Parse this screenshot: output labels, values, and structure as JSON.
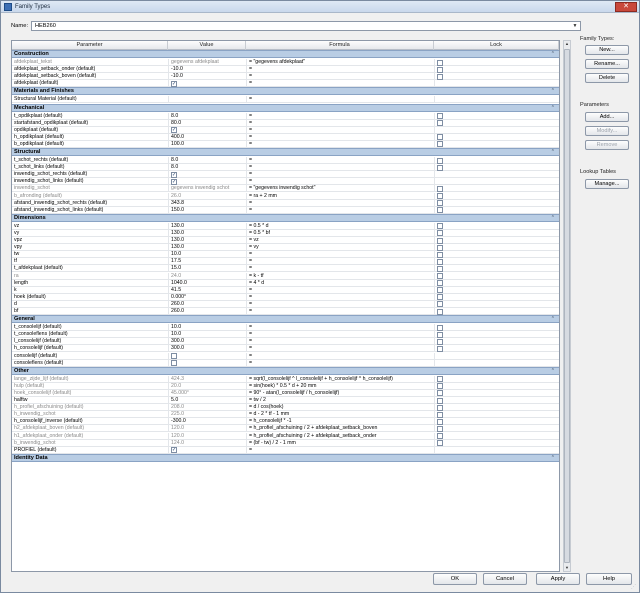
{
  "window": {
    "title": "Family Types",
    "close_label": "✕"
  },
  "name": {
    "label": "Name:",
    "value": "HEB260"
  },
  "headers": {
    "parameter": "Parameter",
    "value": "Value",
    "formula": "Formula",
    "lock": "Lock"
  },
  "collapse_glyph": "⌃",
  "sections": [
    {
      "title": "Construction",
      "rows": [
        {
          "p": "afdekplaat_tekst",
          "v": "gegevens afdekplaat",
          "f": "= \"gegevens afdekplaat\"",
          "lock": false,
          "ro": true
        },
        {
          "p": "afdekplaat_setback_onder (default)",
          "v": "-10.0",
          "f": "=",
          "lock": false
        },
        {
          "p": "afdekplaat_setback_boven (default)",
          "v": "-10.0",
          "f": "=",
          "lock": false
        },
        {
          "p": "afdekplaat (default)",
          "v": "✓",
          "vcb": true,
          "f": "=",
          "lock": null
        }
      ]
    },
    {
      "title": "Materials and Finishes",
      "rows": [
        {
          "p": "Structural Material (default)",
          "v": "",
          "f": "=",
          "lock": null
        }
      ]
    },
    {
      "title": "Mechanical",
      "rows": [
        {
          "p": "t_opdikplaat (default)",
          "v": "8.0",
          "f": "=",
          "lock": false
        },
        {
          "p": "startafstand_opdikplaat (default)",
          "v": "80.0",
          "f": "=",
          "lock": false
        },
        {
          "p": "opdikplaat (default)",
          "v": "✓",
          "vcb": true,
          "f": "=",
          "lock": null
        },
        {
          "p": "h_opdikplaat (default)",
          "v": "400.0",
          "f": "=",
          "lock": false
        },
        {
          "p": "b_opdikplaat (default)",
          "v": "100.0",
          "f": "=",
          "lock": false
        }
      ]
    },
    {
      "title": "Structural",
      "rows": [
        {
          "p": "t_schot_rechts (default)",
          "v": "8.0",
          "f": "=",
          "lock": false
        },
        {
          "p": "t_schot_links (default)",
          "v": "8.0",
          "f": "=",
          "lock": false
        },
        {
          "p": "inwendig_schot_rechts (default)",
          "v": "✓",
          "vcb": true,
          "f": "=",
          "lock": null
        },
        {
          "p": "inwendig_schot_links (default)",
          "v": "✓",
          "vcb": true,
          "f": "=",
          "lock": null
        },
        {
          "p": "inwendig_schot",
          "v": "gegevens inwendig schot",
          "f": "= \"gegevens inwendig schot\"",
          "lock": false,
          "ro": true
        },
        {
          "p": "b_afronding (default)",
          "v": "26.0",
          "f": "= ra + 2 mm",
          "lock": false,
          "ro": true
        },
        {
          "p": "afstand_inwendig_schot_rechts (default)",
          "v": "343.8",
          "f": "=",
          "lock": false
        },
        {
          "p": "afstand_inwendig_schot_links (default)",
          "v": "150.0",
          "f": "=",
          "lock": false
        }
      ]
    },
    {
      "title": "Dimensions",
      "rows": [
        {
          "p": "vz",
          "v": "130.0",
          "f": "= 0.5 * d",
          "lock": false
        },
        {
          "p": "vy",
          "v": "130.0",
          "f": "= 0.5 * bf",
          "lock": false
        },
        {
          "p": "vpz",
          "v": "130.0",
          "f": "= vz",
          "lock": false
        },
        {
          "p": "vpy",
          "v": "130.0",
          "f": "= vy",
          "lock": false
        },
        {
          "p": "tw",
          "v": "10.0",
          "f": "=",
          "lock": false
        },
        {
          "p": "tf",
          "v": "17.5",
          "f": "=",
          "lock": false
        },
        {
          "p": "t_afdekplaat (default)",
          "v": "15.0",
          "f": "=",
          "lock": false
        },
        {
          "p": "ra",
          "v": "24.0",
          "f": "= k - tf",
          "lock": false,
          "ro": true
        },
        {
          "p": "length",
          "v": "1040.0",
          "f": "= 4 * d",
          "lock": false
        },
        {
          "p": "k",
          "v": "41.5",
          "f": "=",
          "lock": false
        },
        {
          "p": "hoek (default)",
          "v": "0.000°",
          "f": "=",
          "lock": false
        },
        {
          "p": "d",
          "v": "260.0",
          "f": "=",
          "lock": false
        },
        {
          "p": "bf",
          "v": "260.0",
          "f": "=",
          "lock": false
        }
      ]
    },
    {
      "title": "General",
      "rows": [
        {
          "p": "t_consolelijf (default)",
          "v": "10.0",
          "f": "=",
          "lock": false
        },
        {
          "p": "t_consoleflens (default)",
          "v": "10.0",
          "f": "=",
          "lock": false
        },
        {
          "p": "l_consolelijf (default)",
          "v": "300.0",
          "f": "=",
          "lock": false
        },
        {
          "p": "h_consolelijf (default)",
          "v": "300.0",
          "f": "=",
          "lock": false
        },
        {
          "p": "consolelijf (default)",
          "v": "",
          "vcb": true,
          "f": "=",
          "lock": null
        },
        {
          "p": "consoleflens (default)",
          "v": "",
          "vcb": true,
          "f": "=",
          "lock": null
        }
      ]
    },
    {
      "title": "Other",
      "rows": [
        {
          "p": "lange_zijde_lijf (default)",
          "v": "424.3",
          "f": "= sqrt(l_consolelijf ^ l_consolelijf + h_consolelijf ^ h_consolelijf)",
          "lock": false,
          "ro": true
        },
        {
          "p": "hulp (default)",
          "v": "20.0",
          "f": "= sin(hoek) * 0.5 * d + 20 mm",
          "lock": false,
          "ro": true
        },
        {
          "p": "hoek_consolelijf (default)",
          "v": "45.000°",
          "f": "= 90° - atan(l_consolelijf / h_consolelijf)",
          "lock": false,
          "ro": true
        },
        {
          "p": "halftw",
          "v": "5.0",
          "f": "= tw / 2",
          "lock": false
        },
        {
          "p": "h_profiel_afschuining (default)",
          "v": "208.0",
          "f": "= d / cos(hoek)",
          "lock": false,
          "ro": true
        },
        {
          "p": "h_inwendig_schot",
          "v": "225.0",
          "f": "= d - 2 * tf - 1 mm",
          "lock": false,
          "ro": true
        },
        {
          "p": "h_consolelijf_inverse (default)",
          "v": "-300.0",
          "f": "= h_consolelijf * -1",
          "lock": false
        },
        {
          "p": "h2_afdekplaat_boven (default)",
          "v": "120.0",
          "f": "= h_profiel_afschuining / 2 + afdekplaat_setback_boven",
          "lock": false,
          "ro": true
        },
        {
          "p": "h1_afdekplaat_onder (default)",
          "v": "120.0",
          "f": "= h_profiel_afschuining / 2 + afdekplaat_setback_onder",
          "lock": false,
          "ro": true
        },
        {
          "p": "b_inwendig_schot",
          "v": "124.0",
          "f": "= (bf - tw) / 2 - 1 mm",
          "lock": false,
          "ro": true
        },
        {
          "p": "PROFIEL (default)",
          "v": "✓",
          "vcb": true,
          "f": "=",
          "lock": null
        }
      ]
    },
    {
      "title": "Identity Data",
      "rows": []
    }
  ],
  "side": {
    "family_types": {
      "title": "Family Types:",
      "new": "New...",
      "rename": "Rename...",
      "delete": "Delete"
    },
    "parameters": {
      "title": "Parameters",
      "add": "Add...",
      "modify": "Modify...",
      "remove": "Remove"
    },
    "lookup": {
      "title": "Lookup Tables",
      "manage": "Manage..."
    }
  },
  "footer": {
    "ok": "OK",
    "cancel": "Cancel",
    "apply": "Apply",
    "help": "Help"
  }
}
